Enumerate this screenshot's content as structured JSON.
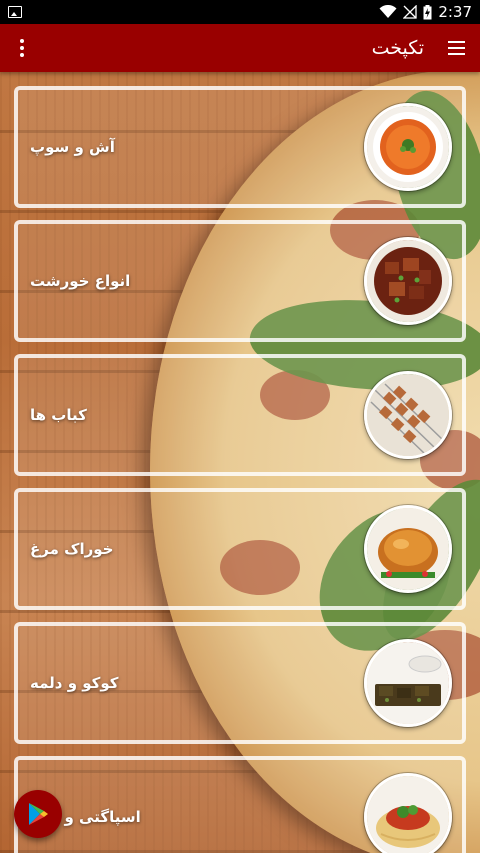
{
  "status_bar": {
    "time": "2:37",
    "icons": [
      "image-notification-icon",
      "wifi-icon",
      "no-signal-icon",
      "battery-charging-icon"
    ]
  },
  "app_bar": {
    "title": "تکپخت",
    "menu_icon": "hamburger-menu-icon",
    "overflow_icon": "more-vertical-icon"
  },
  "colors": {
    "app_bar": "#990000",
    "status_bar": "#000000",
    "card_border": "#ffffff",
    "fab": "#990000"
  },
  "categories": [
    {
      "label": "آش و سوپ",
      "image": "soup-bowl-image"
    },
    {
      "label": "انواع خورشت",
      "image": "stew-image"
    },
    {
      "label": "کباب ها",
      "image": "kebab-skewers-image"
    },
    {
      "label": "خوراک مرغ",
      "image": "roast-chicken-image"
    },
    {
      "label": "کوکو و دلمه",
      "image": "kuku-image"
    },
    {
      "label": "اسپاگتی و ماکا",
      "image": "spaghetti-image"
    }
  ],
  "fab": {
    "icon": "play-store-icon"
  }
}
